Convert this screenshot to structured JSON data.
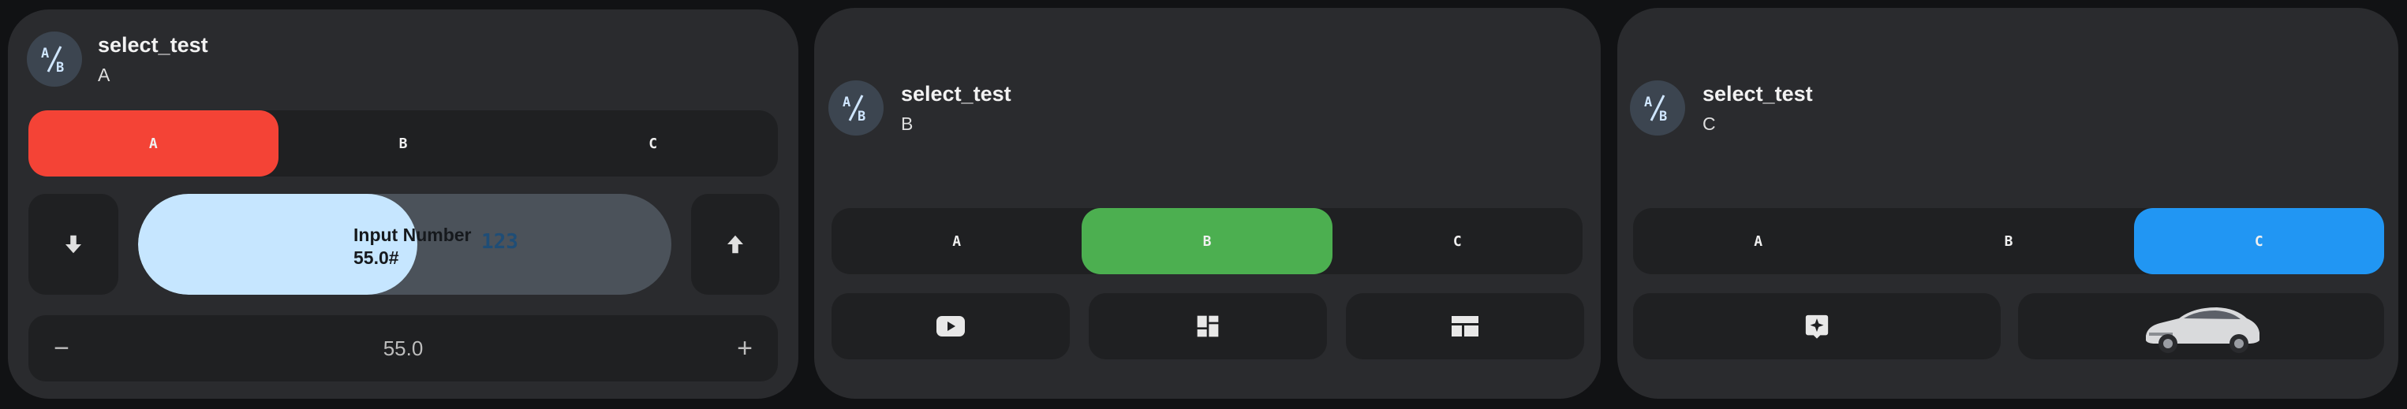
{
  "card1": {
    "entity_name": "select_test",
    "state": "A",
    "options": [
      "A",
      "B",
      "C"
    ],
    "selected": "A",
    "active_color": "#f44336",
    "slider": {
      "label_line1": "Input Number",
      "label_line2": "55.0#",
      "value_display": "123",
      "level_percent": 55
    },
    "counter": {
      "minus": "−",
      "plus": "+",
      "value": "55.0"
    },
    "icons": {
      "down": "arrow-down-icon",
      "up": "arrow-up-icon",
      "entity": "ab-select-icon"
    }
  },
  "card2": {
    "entity_name": "select_test",
    "state": "B",
    "options": [
      "A",
      "B",
      "C"
    ],
    "selected": "B",
    "active_color": "#4caf50",
    "icons": [
      "youtube-icon",
      "dashboard-icon",
      "table-layout-icon"
    ]
  },
  "card3": {
    "entity_name": "select_test",
    "state": "C",
    "options": [
      "A",
      "B",
      "C"
    ],
    "selected": "C",
    "active_color": "#2196f3",
    "icons": [
      "sparkle-icon",
      "car-image"
    ]
  }
}
